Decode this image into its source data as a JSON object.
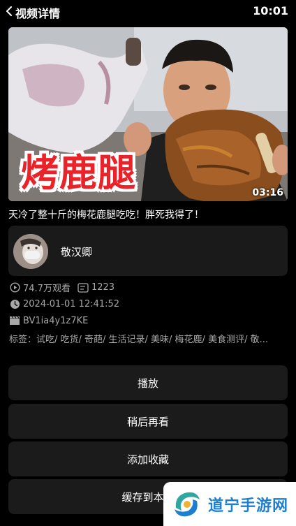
{
  "header": {
    "title": "视频详情",
    "time": "10:01"
  },
  "video": {
    "overlay_text": "烤鹿腿",
    "duration": "03:16",
    "title": "天冷了整十斤的梅花鹿腿吃吃！胖死我得了！"
  },
  "author": {
    "name": "敬汉卿"
  },
  "meta": {
    "views": "74.7万观看",
    "danmaku": "1223",
    "date": "2024-01-01 12:41:52",
    "bvid": "BV1ia4y1z7KE",
    "tags": "标签：试吃/ 吃货/ 奇葩/ 生活记录/ 美味/ 梅花鹿/ 美食测评/ 敬..."
  },
  "actions": {
    "play": "播放",
    "watch_later": "稍后再看",
    "favorite": "添加收藏",
    "cache": "缓存到本地"
  },
  "watermark": {
    "text": "道宁手游网"
  },
  "colors": {
    "background": "#000000",
    "card": "#1b1b1b",
    "meta_text": "#a8a8a8",
    "overlay_red": "#e8232a",
    "watermark_blue": "#1d7fd0"
  }
}
